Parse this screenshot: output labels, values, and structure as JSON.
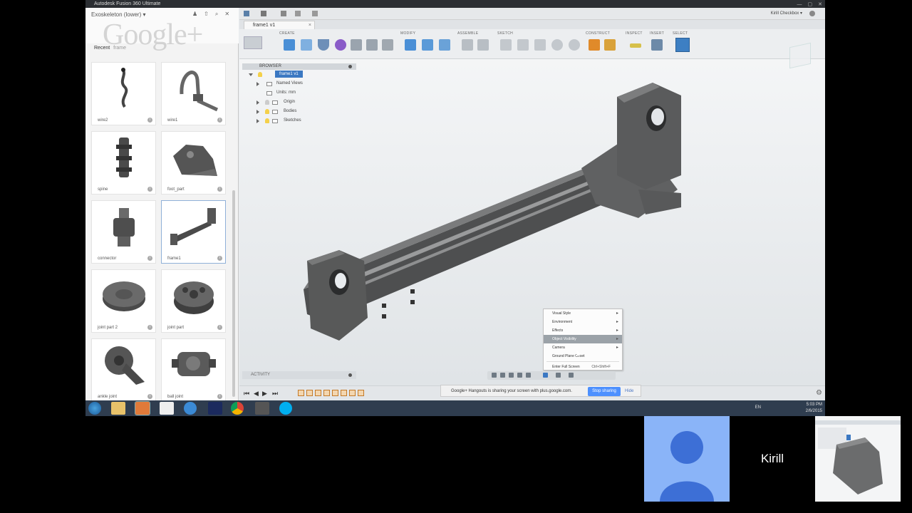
{
  "window": {
    "title": "Autodesk Fusion 360 Ultimate",
    "buttons": [
      "—",
      "▢",
      "✕"
    ]
  },
  "data_panel": {
    "project": "Exoskeleton (lower)",
    "watermark": "Google+",
    "search_label": "Recent",
    "search_placeholder": "frame",
    "items": [
      {
        "label": "wire2",
        "icon": "wire-model"
      },
      {
        "label": "wire1",
        "icon": "hook-wire-model"
      },
      {
        "label": "spine",
        "icon": "spine-model"
      },
      {
        "label": "foot_part",
        "icon": "foot-model"
      },
      {
        "label": "connector",
        "icon": "connector-model"
      },
      {
        "label": "frame1",
        "icon": "frame-model",
        "selected": true
      },
      {
        "label": "joint part 2",
        "icon": "disc-model"
      },
      {
        "label": "joint part",
        "icon": "pulley-model"
      },
      {
        "label": "ankle joint",
        "icon": "ankle-joint-model"
      },
      {
        "label": "ball joint",
        "icon": "ball-joint-model"
      }
    ]
  },
  "app": {
    "user": "Kirill Checkbox",
    "doc_tab": "frame1 v1"
  },
  "ribbon": {
    "groups": [
      "CREATE",
      "MODIFY",
      "ASSEMBLE",
      "SKETCH",
      "CONSTRUCT",
      "INSPECT",
      "INSERT",
      "SELECT"
    ]
  },
  "browser": {
    "title": "BROWSER",
    "root": "frame1 v1",
    "nodes": [
      "Named Views",
      "Units: mm",
      "Origin",
      "Bodies",
      "Sketches"
    ]
  },
  "context_menu": {
    "items": [
      {
        "label": "Visual Style",
        "arrow": "▸"
      },
      {
        "label": "Environment",
        "arrow": "▸"
      },
      {
        "label": "Effects",
        "arrow": "▸"
      },
      {
        "label": "Object Visibility",
        "arrow": "▸",
        "highlighted": true
      },
      {
        "label": "Camera",
        "arrow": "▸"
      },
      {
        "label": "Ground Plane Offset",
        "arrow": ""
      },
      {
        "label": "Enter Full Screen",
        "shortcut": "Ctrl+Shift+F"
      }
    ]
  },
  "activity": {
    "title": "ACTIVITY"
  },
  "timeline": {
    "controls": [
      "⏮",
      "◀",
      "▶",
      "⏭"
    ]
  },
  "sharebar": {
    "message": "Google+ Hangouts is sharing your screen with plus.google.com.",
    "stop_label": "Stop sharing",
    "hide_label": "Hide"
  },
  "taskbar": {
    "lang": "EN",
    "time": "5:03 PM",
    "date": "2/6/2015"
  },
  "hangout": {
    "participant_name": "Kirill"
  },
  "colors": {
    "accent": "#3b78c2",
    "avatar_bg": "#8ab4f8",
    "avatar_fg": "#3d6fd6",
    "stop_button": "#4d90fe"
  }
}
